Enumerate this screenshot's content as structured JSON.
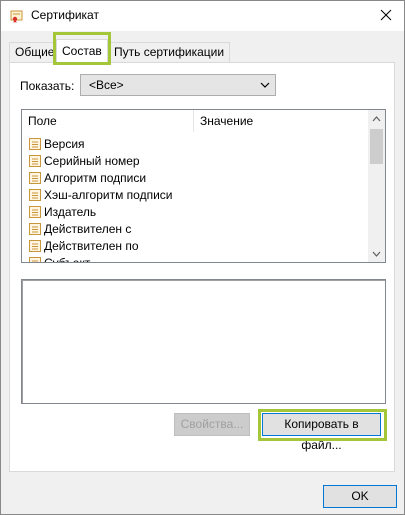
{
  "window": {
    "title": "Сертификат"
  },
  "tabs": [
    {
      "label": "Общие"
    },
    {
      "label": "Состав"
    },
    {
      "label": "Путь сертификации"
    }
  ],
  "show": {
    "label": "Показать:",
    "value": "<Все>"
  },
  "list": {
    "columns": [
      "Поле",
      "Значение"
    ],
    "rows": [
      {
        "field": "Версия",
        "value": ""
      },
      {
        "field": "Серийный номер",
        "value": ""
      },
      {
        "field": "Алгоритм подписи",
        "value": ""
      },
      {
        "field": "Хэш-алгоритм подписи",
        "value": ""
      },
      {
        "field": "Издатель",
        "value": ""
      },
      {
        "field": "Действителен с",
        "value": ""
      },
      {
        "field": "Действителен по",
        "value": ""
      },
      {
        "field": "Субъект",
        "value": ""
      }
    ]
  },
  "buttons": {
    "properties": "Свойства...",
    "copy_to_file": "Копировать в файл...",
    "ok": "OK"
  },
  "colors": {
    "highlight": "#a4c639",
    "focus_border": "#0078d7"
  }
}
